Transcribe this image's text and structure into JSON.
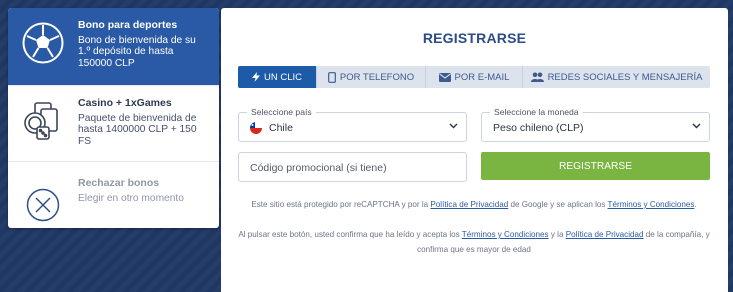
{
  "bonuses": [
    {
      "title": "Bono para deportes",
      "desc": "Bono de bienvenida de su 1.º depósito de hasta 150000 CLP",
      "icon": "soccer-ball-icon",
      "active": true
    },
    {
      "title": "Casino + 1xGames",
      "desc": "Paquete de bienvenida de hasta 1400000 CLP + 150 FS",
      "icon": "casino-cards-dice-icon",
      "active": false
    },
    {
      "title": "Rechazar bonos",
      "desc": "Elegir en otro momento",
      "icon": "close-circle-icon",
      "active": false
    }
  ],
  "register": {
    "title": "REGISTRARSE",
    "tabs": [
      {
        "label": "UN CLIC",
        "icon": "lightning-icon"
      },
      {
        "label": "POR TELEFONO",
        "icon": "phone-icon"
      },
      {
        "label": "POR E-MAIL",
        "icon": "envelope-icon"
      },
      {
        "label": "REDES SOCIALES Y MENSAJERÍA",
        "icon": "people-icon"
      }
    ],
    "country": {
      "label": "Seleccione país",
      "value": "Chile"
    },
    "currency": {
      "label": "Seleccione la moneda",
      "value": "Peso chileno (CLP)"
    },
    "promo_placeholder": "Código promocional (si tiene)",
    "submit_label": "REGISTRARSE",
    "recaptcha": {
      "pre": "Este sitio está protegido por reCAPTCHA y por la ",
      "privacy": "Política de Privacidad",
      "mid": " de Google y se aplican los ",
      "terms": "Términos y Condiciones",
      "post": "."
    },
    "confirm": {
      "pre": "Al pulsar este botón, usted confirma que ha leído y acepta los ",
      "terms": "Términos y Condiciones",
      "mid": " y la ",
      "privacy": "Política de Privacidad",
      "post": " de la compañía, y confirma que es mayor de edad"
    }
  },
  "colors": {
    "accent": "#2a5aa5",
    "tab_active": "#1d5aa8",
    "submit": "#7ab542",
    "background": "#1f3763"
  }
}
